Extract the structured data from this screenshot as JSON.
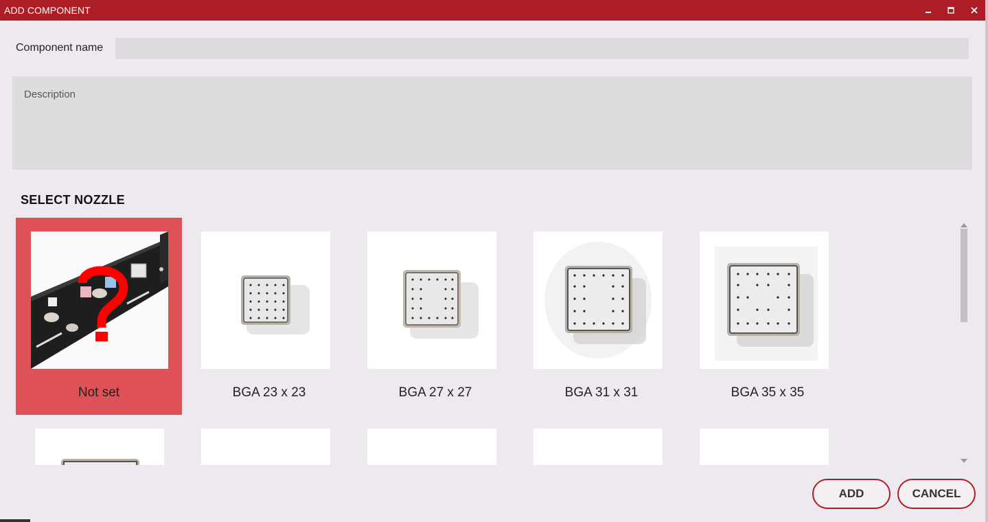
{
  "window": {
    "title": "ADD COMPONENT",
    "accent": "#ad1d25",
    "controls": [
      "minimize-icon",
      "maximize-icon",
      "close-icon"
    ]
  },
  "form": {
    "name_label": "Component name",
    "name_value": "",
    "description_placeholder": "Description",
    "description_value": ""
  },
  "nozzle": {
    "section_title": "SELECT NOZZLE",
    "selected_index": 0,
    "selected_color": "#dd5157",
    "items": [
      {
        "label": "Not set",
        "image": "question-mark-nozzle-tray"
      },
      {
        "label": "BGA 23 x 23",
        "image": "bga-nozzle"
      },
      {
        "label": "BGA 27 x 27",
        "image": "bga-nozzle"
      },
      {
        "label": "BGA 31 x 31",
        "image": "bga-nozzle"
      },
      {
        "label": "BGA 35 x 35",
        "image": "bga-nozzle"
      }
    ]
  },
  "actions": {
    "add_label": "ADD",
    "cancel_label": "CANCEL"
  }
}
